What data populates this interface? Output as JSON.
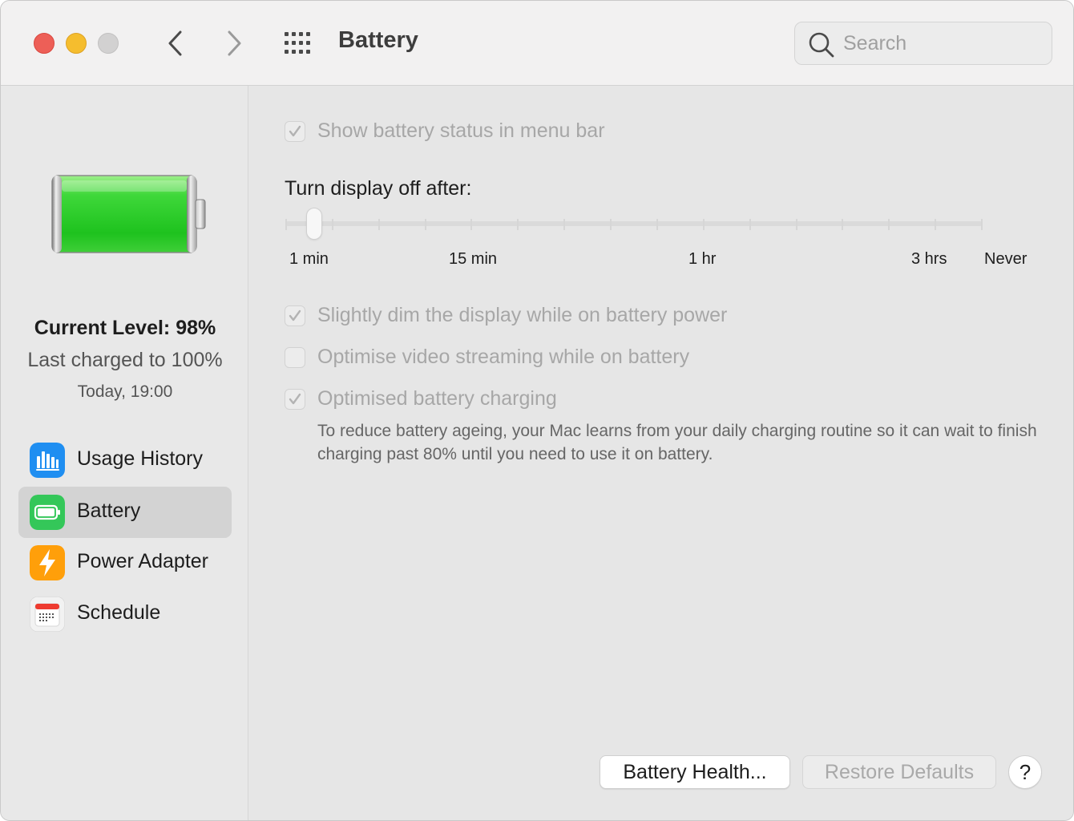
{
  "window": {
    "title": "Battery",
    "traffic_lights": {
      "close_color": "#ed5f57",
      "minimize_color": "#f5bd2e",
      "zoom_color": "#d2d1d1"
    },
    "nav": {
      "back_icon": "chevron-left-icon",
      "forward_icon": "chevron-right-icon",
      "grid_icon": "grid-icon"
    },
    "search": {
      "placeholder": "Search",
      "icon": "search-icon"
    }
  },
  "sidebar": {
    "battery_graphic": {
      "icon": "battery-full-icon",
      "fill_color": "#29c829",
      "level_fraction": 0.98
    },
    "current_level": "Current Level: 98%",
    "last_charged": "Last charged to 100%",
    "last_charged_time": "Today, 19:00",
    "items": [
      {
        "label": "Usage History",
        "icon": "usage-history-icon",
        "selected": false
      },
      {
        "label": "Battery",
        "icon": "battery-icon",
        "selected": true
      },
      {
        "label": "Power Adapter",
        "icon": "power-adapter-icon",
        "selected": false
      },
      {
        "label": "Schedule",
        "icon": "schedule-icon",
        "selected": false
      }
    ]
  },
  "main": {
    "show_status": {
      "label": "Show battery status in menu bar",
      "checked": true,
      "enabled": false
    },
    "display_off": {
      "label": "Turn display off after:",
      "slider_labels": [
        "1 min",
        "15 min",
        "1 hr",
        "3 hrs",
        "Never"
      ],
      "value": "1 min",
      "tick_count": 16
    },
    "dim_display": {
      "label": "Slightly dim the display while on battery power",
      "checked": true,
      "enabled": false
    },
    "video_streaming": {
      "label": "Optimise video streaming while on battery",
      "checked": false,
      "enabled": false
    },
    "optimised_charging": {
      "label": "Optimised battery charging",
      "checked": true,
      "enabled": false,
      "description": "To reduce battery ageing, your Mac learns from your daily charging routine so it can wait to finish charging past 80% until you need to use it on battery."
    },
    "buttons": {
      "battery_health": "Battery Health...",
      "restore_defaults": "Restore Defaults",
      "help": "?"
    }
  }
}
